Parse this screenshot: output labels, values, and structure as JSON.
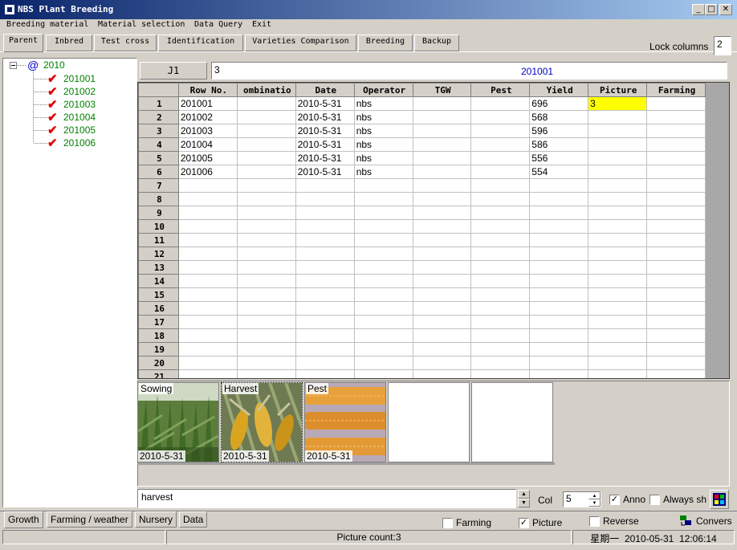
{
  "window": {
    "title": "NBS Plant Breeding"
  },
  "menu": [
    "Breeding material",
    "Material selection",
    "Data Query",
    "Exit"
  ],
  "tabs": [
    "Parent",
    "Inbred",
    "Test cross",
    "Identification",
    "Varieties Comparison",
    "Breeding",
    "Backup"
  ],
  "lock_columns": {
    "label": "Lock columns",
    "value": "2"
  },
  "tree": {
    "root": "2010",
    "children": [
      "201001",
      "201002",
      "201003",
      "201004",
      "201005",
      "201006"
    ]
  },
  "cell_bar": {
    "ref": "J1",
    "value": "3",
    "row_label": "201001"
  },
  "grid": {
    "columns": [
      "Row No.",
      "ombinatio",
      "Date",
      "Operator",
      "TGW",
      "Pest",
      "Yield",
      "Picture",
      "Farming"
    ],
    "row_numbers": [
      "1",
      "2",
      "3",
      "4",
      "5",
      "6",
      "7",
      "8",
      "9",
      "10",
      "11",
      "12",
      "13",
      "14",
      "15",
      "16",
      "17",
      "18",
      "19",
      "20",
      "21"
    ],
    "rows": [
      [
        "201001",
        "",
        "2010-5-31",
        "nbs",
        "",
        "",
        "696",
        "3",
        ""
      ],
      [
        "201002",
        "",
        "2010-5-31",
        "nbs",
        "",
        "",
        "568",
        "",
        ""
      ],
      [
        "201003",
        "",
        "2010-5-31",
        "nbs",
        "",
        "",
        "596",
        "",
        ""
      ],
      [
        "201004",
        "",
        "2010-5-31",
        "nbs",
        "",
        "",
        "586",
        "",
        ""
      ],
      [
        "201005",
        "",
        "2010-5-31",
        "nbs",
        "",
        "",
        "556",
        "",
        ""
      ],
      [
        "201006",
        "",
        "2010-5-31",
        "nbs",
        "",
        "",
        "554",
        "",
        ""
      ]
    ],
    "highlight_color": "#ffff00"
  },
  "photos": [
    {
      "label": "Sowing",
      "date": "2010-5-31"
    },
    {
      "label": "Harvest",
      "date": "2010-5-31"
    },
    {
      "label": "Pest",
      "date": "2010-5-31"
    }
  ],
  "caption_input": "harvest",
  "col": {
    "label": "Col",
    "value": "5"
  },
  "anno": {
    "label": "Anno",
    "checked": true
  },
  "always_show": {
    "label": "Always sh",
    "checked": false
  },
  "bottom_tabs": [
    "Growth",
    "Farming / weather",
    "Nursery",
    "Data"
  ],
  "options": {
    "farming": {
      "label": "Farming",
      "checked": false
    },
    "picture": {
      "label": "Picture",
      "checked": true
    },
    "reverse": {
      "label": "Reverse",
      "checked": false
    },
    "convert": {
      "label": "Convers"
    }
  },
  "status": {
    "picture_count": "Picture count:3",
    "datetime": "星期一  2010-05-31  12:06:14"
  }
}
